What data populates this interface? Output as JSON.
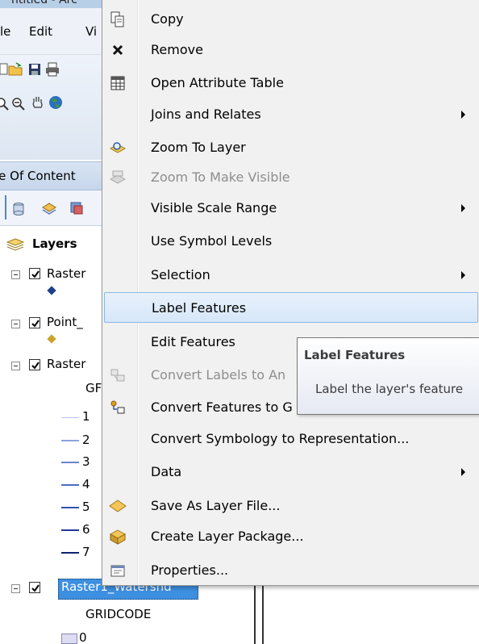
{
  "window": {
    "title_fragment": "ntitled - Arc"
  },
  "menubar": {
    "items": [
      "le",
      "Edit",
      "Vi"
    ]
  },
  "toc": {
    "title_fragment": "le Of Content",
    "root_label": "Layers",
    "layers": [
      {
        "label": "Raster",
        "checked": true
      },
      {
        "label": "Point_",
        "checked": true
      },
      {
        "label": "Raster",
        "checked": true,
        "field": "GF"
      },
      {
        "label": "Raster1_Watershd",
        "checked": true,
        "field": "GRIDCODE"
      }
    ],
    "legend_values": [
      "1",
      "2",
      "3",
      "4",
      "5",
      "6",
      "7"
    ],
    "last_legend_value": "0"
  },
  "context_menu": {
    "items": [
      {
        "label": "Copy",
        "icon": "copy-icon",
        "enabled": true,
        "submenu": false
      },
      {
        "label": "Remove",
        "icon": "remove-icon",
        "enabled": true,
        "submenu": false
      },
      {
        "label": "Open Attribute Table",
        "icon": "table-icon",
        "enabled": true,
        "submenu": false
      },
      {
        "label": "Joins and Relates",
        "icon": "",
        "enabled": true,
        "submenu": true
      },
      {
        "label": "Zoom To Layer",
        "icon": "zoom-to-layer-icon",
        "enabled": true,
        "submenu": false
      },
      {
        "label": "Zoom To Make Visible",
        "icon": "zoom-to-visible-icon",
        "enabled": false,
        "submenu": false
      },
      {
        "label": "Visible Scale Range",
        "icon": "",
        "enabled": true,
        "submenu": true
      },
      {
        "label": "Use Symbol Levels",
        "icon": "",
        "enabled": true,
        "submenu": false
      },
      {
        "label": "Selection",
        "icon": "",
        "enabled": true,
        "submenu": true
      },
      {
        "label": "Label Features",
        "icon": "",
        "enabled": true,
        "submenu": false,
        "highlighted": true
      },
      {
        "label": "Edit Features",
        "icon": "",
        "enabled": true,
        "submenu": false
      },
      {
        "label": "Convert Labels to An",
        "icon": "convert-labels-icon",
        "enabled": false,
        "submenu": false
      },
      {
        "label": "Convert Features to G",
        "icon": "convert-features-icon",
        "enabled": true,
        "submenu": false
      },
      {
        "label": "Convert Symbology to Representation...",
        "icon": "",
        "enabled": true,
        "submenu": false
      },
      {
        "label": "Data",
        "icon": "",
        "enabled": true,
        "submenu": true
      },
      {
        "label": "Save As Layer File...",
        "icon": "save-layer-icon",
        "enabled": true,
        "submenu": false
      },
      {
        "label": "Create Layer Package...",
        "icon": "layer-package-icon",
        "enabled": true,
        "submenu": false
      },
      {
        "label": "Properties...",
        "icon": "properties-icon",
        "enabled": true,
        "submenu": false
      }
    ]
  },
  "tooltip": {
    "title": "Label Features",
    "body": "Label the layer's feature"
  },
  "colors": {
    "highlight": "#d6e7f9",
    "highlight_border": "#8bb8e8",
    "selected_layer": "#3d8fe0"
  }
}
